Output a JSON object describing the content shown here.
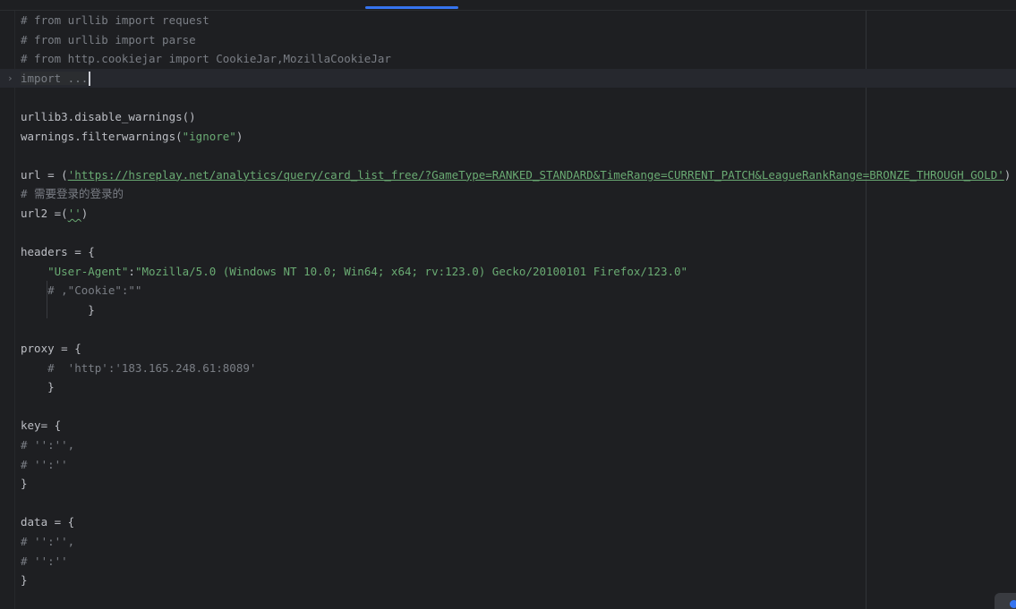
{
  "editor": {
    "lines": [
      {
        "segments": [
          {
            "t": "# from urllib import request",
            "c": "c"
          }
        ]
      },
      {
        "segments": [
          {
            "t": "# from urllib import parse",
            "c": "c"
          }
        ]
      },
      {
        "segments": [
          {
            "t": "# from http.cookiejar import CookieJar,MozillaCookieJar",
            "c": "c"
          }
        ]
      },
      {
        "fold": "›",
        "current": true,
        "segments": [
          {
            "t": "import ...",
            "c": "fold-text"
          }
        ],
        "caret": true
      },
      {
        "segments": []
      },
      {
        "segments": [
          {
            "t": "urllib3.disable_warnings()",
            "c": ""
          }
        ]
      },
      {
        "segments": [
          {
            "t": "warnings.filterwarnings(",
            "c": ""
          },
          {
            "t": "\"ignore\"",
            "c": "s"
          },
          {
            "t": ")",
            "c": ""
          }
        ]
      },
      {
        "segments": []
      },
      {
        "segments": [
          {
            "t": "url = (",
            "c": ""
          },
          {
            "t": "'https://hsreplay.net/analytics/query/card_list_free/?GameType=RANKED_STANDARD&TimeRange=CURRENT_PATCH&LeagueRankRange=BRONZE_THROUGH_GOLD'",
            "c": "url"
          },
          {
            "t": ")",
            "c": ""
          }
        ]
      },
      {
        "segments": [
          {
            "t": "# 需要登录的登录的",
            "c": "c"
          }
        ]
      },
      {
        "segments": [
          {
            "t": "url2 =(",
            "c": ""
          },
          {
            "t": "''",
            "c": "s squiggle"
          },
          {
            "t": ")",
            "c": ""
          }
        ]
      },
      {
        "segments": []
      },
      {
        "segments": [
          {
            "t": "headers = {",
            "c": ""
          }
        ]
      },
      {
        "segments": [
          {
            "t": "    ",
            "c": ""
          },
          {
            "t": "\"User-Agent\"",
            "c": "s"
          },
          {
            "t": ":",
            "c": ""
          },
          {
            "t": "\"Mozilla/5.0 (Windows NT 10.0; Win64; x64; rv:123.0) Gecko/20100101 Firefox/123.0\"",
            "c": "s"
          }
        ]
      },
      {
        "segments": [
          {
            "t": "    # ,\"Cookie\":\"\"",
            "c": "c"
          }
        ]
      },
      {
        "segments": [
          {
            "t": "          }",
            "c": ""
          }
        ]
      },
      {
        "segments": []
      },
      {
        "segments": [
          {
            "t": "proxy = {",
            "c": ""
          }
        ]
      },
      {
        "segments": [
          {
            "t": "    #  'http':'183.165.248.61:8089'",
            "c": "c"
          }
        ]
      },
      {
        "segments": [
          {
            "t": "    }",
            "c": ""
          }
        ]
      },
      {
        "segments": []
      },
      {
        "segments": [
          {
            "t": "key= {",
            "c": ""
          }
        ]
      },
      {
        "segments": [
          {
            "t": "# '':'',",
            "c": "c"
          }
        ]
      },
      {
        "segments": [
          {
            "t": "# '':''",
            "c": "c"
          }
        ]
      },
      {
        "segments": [
          {
            "t": "}",
            "c": ""
          }
        ]
      },
      {
        "segments": []
      },
      {
        "segments": [
          {
            "t": "data = {",
            "c": ""
          }
        ]
      },
      {
        "segments": [
          {
            "t": "# '':'',",
            "c": "c"
          }
        ]
      },
      {
        "segments": [
          {
            "t": "# '':''",
            "c": "c"
          }
        ]
      },
      {
        "segments": [
          {
            "t": "}",
            "c": ""
          }
        ]
      }
    ]
  },
  "icons": {
    "fold_marker": "chevron-right-icon",
    "corner_badge": "notification-icon"
  },
  "colors": {
    "background": "#1e1f22",
    "comment": "#7a7e85",
    "string": "#6aab73",
    "default_text": "#bcbec4",
    "accent": "#3574f0"
  }
}
